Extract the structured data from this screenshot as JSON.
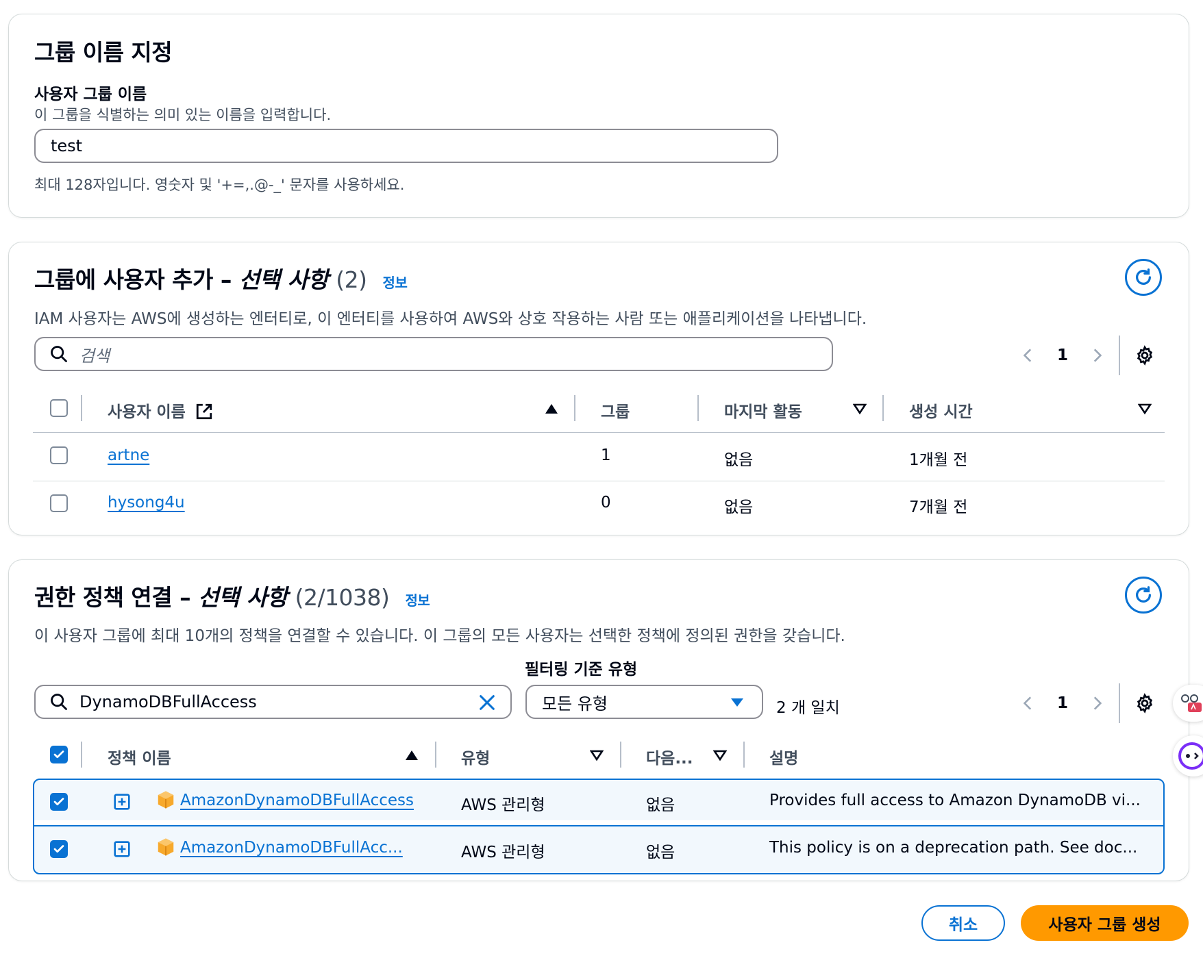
{
  "name_section": {
    "title": "그룹 이름 지정",
    "field_label": "사용자 그룹 이름",
    "field_desc": "이 그룹을 식별하는 의미 있는 이름을 입력합니다.",
    "value": "test",
    "constraint": "최대 128자입니다. 영숫자 및 '+=,.@-_' 문자를 사용하세요."
  },
  "users_section": {
    "title": "그룹에 사용자 추가 –",
    "optional": "선택 사항",
    "count": "(2)",
    "info": "정보",
    "desc": "IAM 사용자는 AWS에 생성하는 엔터티로, 이 엔터티를 사용하여 AWS와 상호 작용하는 사람 또는 애플리케이션을 나타냅니다.",
    "search_placeholder": "검색",
    "page": "1",
    "columns": [
      "사용자 이름",
      "그룹",
      "마지막 활동",
      "생성 시간"
    ],
    "rows": [
      {
        "name": "artne",
        "groups": "1",
        "last": "없음",
        "created": "1개월 전"
      },
      {
        "name": "hysong4u",
        "groups": "0",
        "last": "없음",
        "created": "7개월 전"
      }
    ]
  },
  "policies_section": {
    "title": "권한 정책 연결 –",
    "optional": "선택 사항",
    "count": "(2/1038)",
    "info": "정보",
    "desc": "이 사용자 그룹에 최대 10개의 정책을 연결할 수 있습니다. 이 그룹의 모든 사용자는 선택한 정책에 정의된 권한을 갖습니다.",
    "filter_label": "필터링 기준 유형",
    "search_value": "DynamoDBFullAccess",
    "filter_value": "모든 유형",
    "match_count": "2 개 일치",
    "page": "1",
    "columns": [
      "정책 이름",
      "유형",
      "다음...",
      "설명"
    ],
    "rows": [
      {
        "name": "AmazonDynamoDBFullAccess",
        "type": "AWS 관리형",
        "next": "없음",
        "desc": "Provides full access to Amazon DynamoDB vi..."
      },
      {
        "name": "AmazonDynamoDBFullAcc...",
        "type": "AWS 관리형",
        "next": "없음",
        "desc": "This policy is on a deprecation path. See doc..."
      }
    ]
  },
  "actions": {
    "cancel": "취소",
    "create": "사용자 그룹 생성"
  },
  "colors": {
    "primary": "#0972d3",
    "create_button": "#ff9900",
    "text": "#000716",
    "muted": "#414d5c"
  }
}
